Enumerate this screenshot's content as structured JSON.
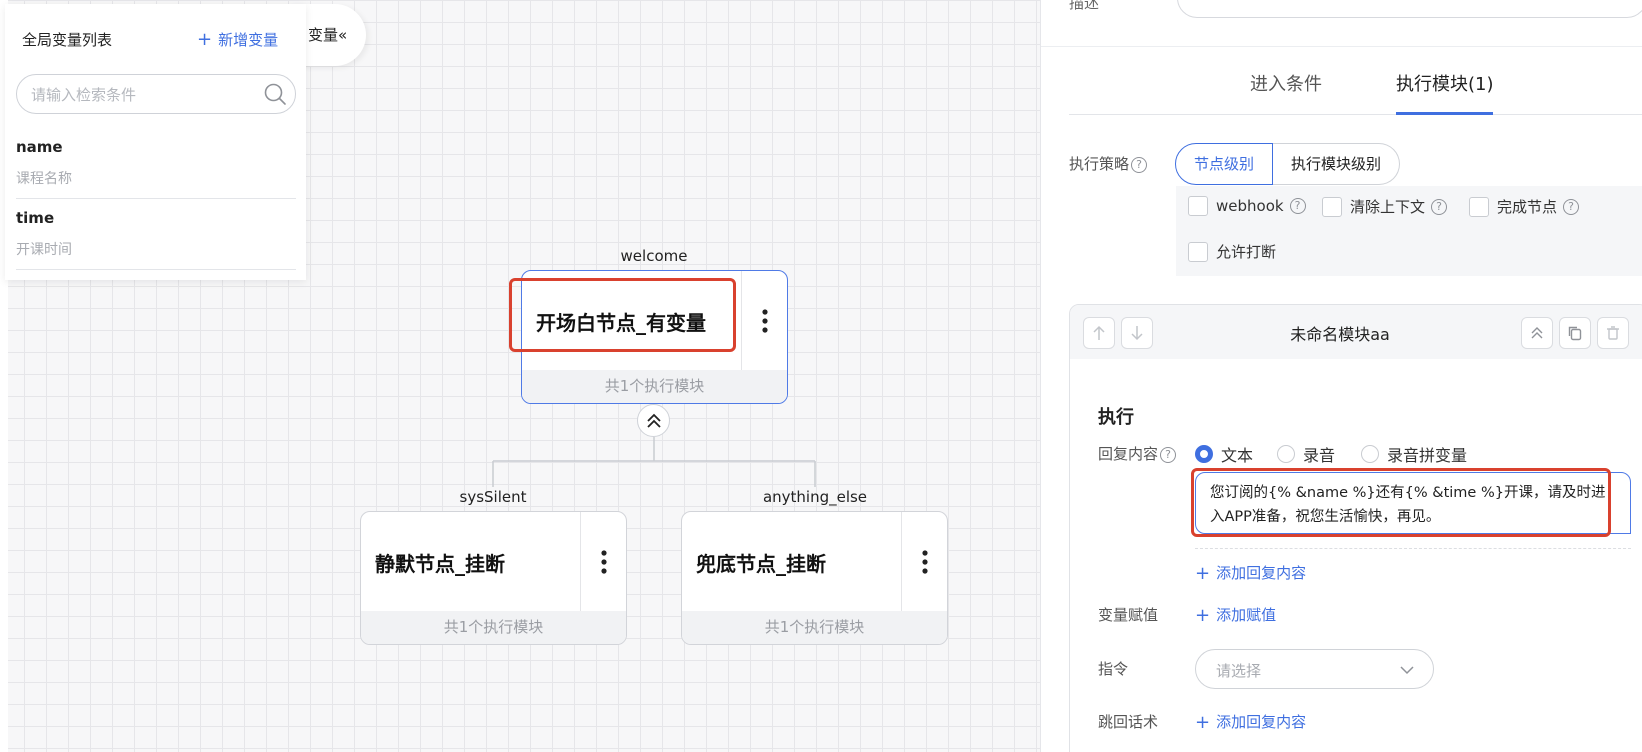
{
  "variables_panel": {
    "title": "全局变量列表",
    "add_button": "新增变量",
    "tab_label": "变量",
    "tab_icon": "«",
    "search_placeholder": "请输入检索条件",
    "items": [
      {
        "name": "name",
        "desc": "课程名称"
      },
      {
        "name": "time",
        "desc": "开课时间"
      }
    ]
  },
  "tree": {
    "root": {
      "label": "welcome",
      "title": "开场白节点_有变量",
      "footer": "共1个执行模块"
    },
    "children": [
      {
        "label": "sysSilent",
        "title": "静默节点_挂断",
        "footer": "共1个执行模块"
      },
      {
        "label": "anything_else",
        "title": "兜底节点_挂断",
        "footer": "共1个执行模块"
      }
    ]
  },
  "right_panel": {
    "desc_label": "描述",
    "tabs": [
      {
        "label": "进入条件"
      },
      {
        "label": "执行模块(1)"
      }
    ],
    "strategy_label": "执行策略",
    "strategy_options": [
      "节点级别",
      "执行模块级别"
    ],
    "checkboxes": [
      {
        "label": "webhook"
      },
      {
        "label": "清除上下文"
      },
      {
        "label": "完成节点"
      },
      {
        "label": "允许打断"
      }
    ],
    "module": {
      "title": "未命名模块aa",
      "section_title": "执行",
      "reply_label": "回复内容",
      "reply_types": [
        "文本",
        "录音",
        "录音拼变量"
      ],
      "reply_text": "您订阅的{% &name %}还有{% &time %}开课，请及时进入APP准备，祝您生活愉快，再见。",
      "add_reply": "添加回复内容",
      "assign_label": "变量赋值",
      "add_assign": "添加赋值",
      "command_label": "指令",
      "command_placeholder": "请选择",
      "jump_label": "跳回话术",
      "add_jump": "添加回复内容"
    }
  },
  "colors": {
    "accent": "#3f6fe0",
    "highlight": "#d9412e"
  }
}
